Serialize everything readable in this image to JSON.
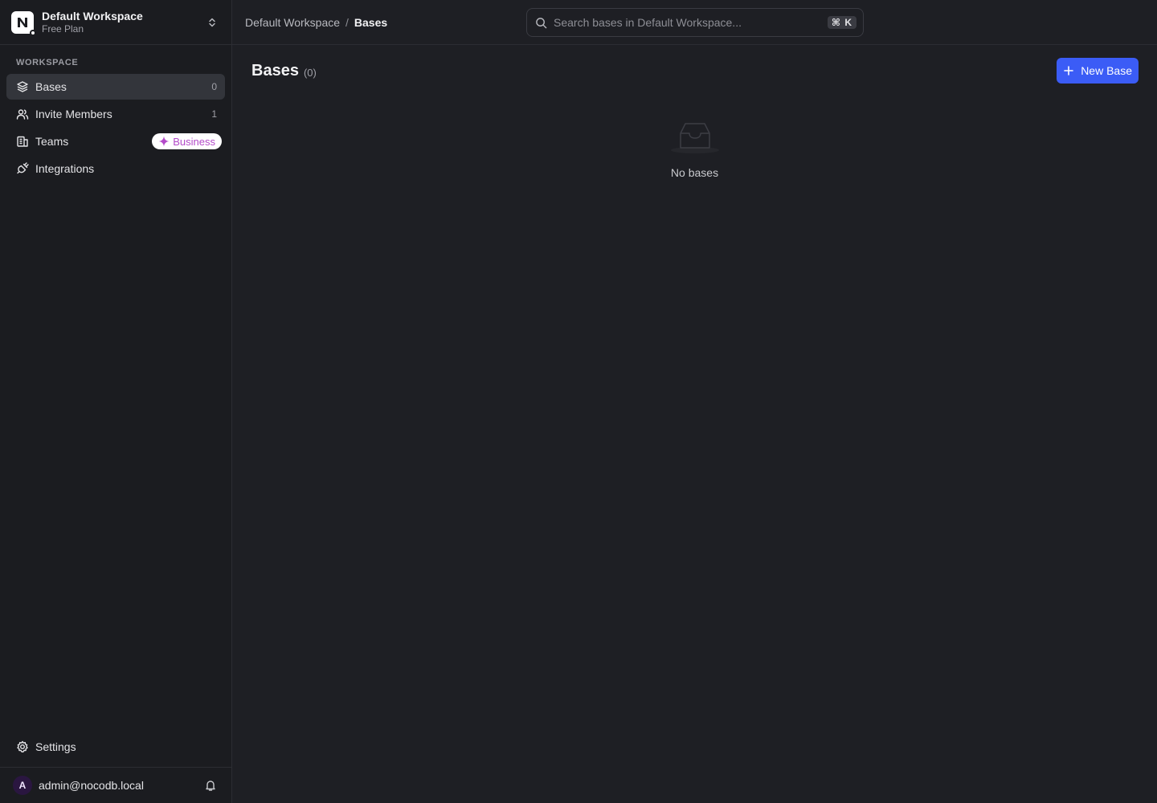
{
  "workspace": {
    "name": "Default Workspace",
    "plan": "Free Plan"
  },
  "sidebar": {
    "section_label": "WORKSPACE",
    "items": [
      {
        "label": "Bases",
        "count": "0",
        "icon": "layers-icon"
      },
      {
        "label": "Invite Members",
        "count": "1",
        "icon": "users-icon"
      },
      {
        "label": "Teams",
        "badge": "Business",
        "icon": "building-icon"
      },
      {
        "label": "Integrations",
        "icon": "plug-icon"
      }
    ],
    "settings_label": "Settings"
  },
  "user": {
    "avatar_initial": "A",
    "email": "admin@nocodb.local"
  },
  "topbar": {
    "breadcrumb": {
      "parent": "Default Workspace",
      "separator": "/",
      "current": "Bases"
    },
    "search": {
      "placeholder": "Search bases in Default Workspace...",
      "shortcut": "⌘ K"
    }
  },
  "page": {
    "title": "Bases",
    "count": "(0)",
    "new_button_label": "New Base",
    "empty_text": "No bases"
  },
  "colors": {
    "accent": "#3b5cf6",
    "background": "#1e1f24",
    "sidebar": "#1b1c20",
    "business_badge_text": "#b34ac9"
  }
}
